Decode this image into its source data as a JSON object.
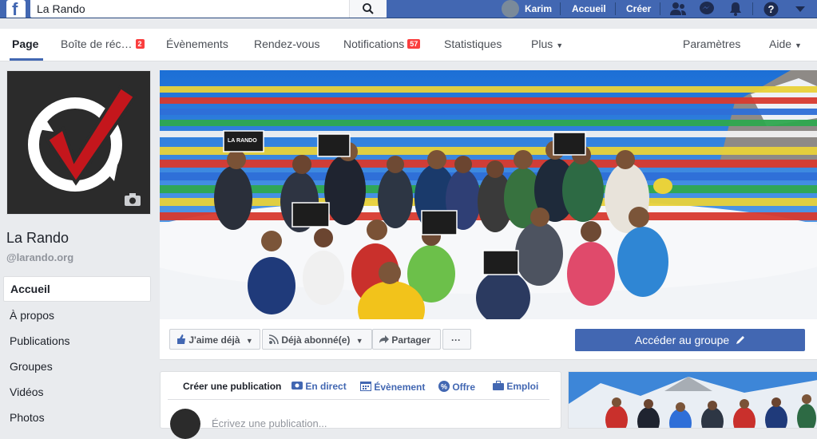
{
  "topbar": {
    "search_value": "La Rando",
    "user_name": "Karim",
    "home_label": "Accueil",
    "create_label": "Créer"
  },
  "page_nav": {
    "items": [
      {
        "label": "Page",
        "badge": ""
      },
      {
        "label": "Boîte de réc…",
        "badge": "2"
      },
      {
        "label": "Évènements",
        "badge": ""
      },
      {
        "label": "Rendez-vous",
        "badge": ""
      },
      {
        "label": "Notifications",
        "badge": "57"
      },
      {
        "label": "Statistiques",
        "badge": ""
      },
      {
        "label": "Plus",
        "badge": ""
      }
    ],
    "settings_label": "Paramètres",
    "help_label": "Aide"
  },
  "page": {
    "name": "La Rando",
    "handle": "@larando.org",
    "cover_banner_text": "LA RANDO"
  },
  "left_nav": {
    "items": [
      "Accueil",
      "À propos",
      "Publications",
      "Groupes",
      "Vidéos",
      "Photos"
    ]
  },
  "actions": {
    "like_label": "J'aime déjà",
    "subscribe_label": "Déjà abonné(e)",
    "share_label": "Partager",
    "more_label": "···",
    "group_label": "Accéder au groupe"
  },
  "composer": {
    "tabs": [
      "Créer une publication",
      "En direct",
      "Évènement",
      "Offre",
      "Emploi"
    ],
    "placeholder": "Écrivez une publication..."
  },
  "colors": {
    "brand_blue": "#4267b2",
    "badge_red": "#fa3e3e",
    "logo_red": "#c4161c"
  }
}
